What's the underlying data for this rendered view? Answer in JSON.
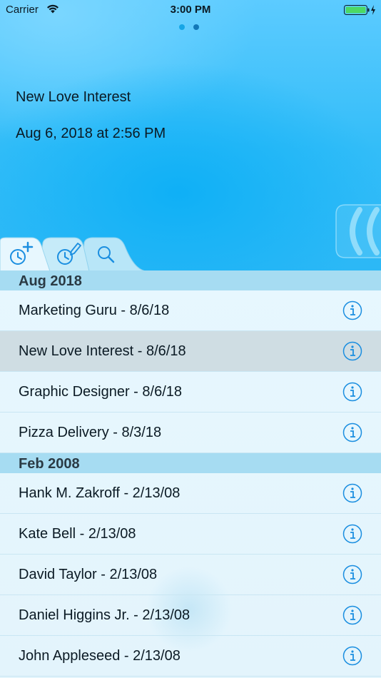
{
  "status_bar": {
    "carrier": "Carrier",
    "time": "3:00 PM",
    "battery_level": 1.0,
    "charging": true
  },
  "page_indicator": {
    "count": 2,
    "active_index": 1
  },
  "entry": {
    "title": "New Love Interest",
    "datetime": "Aug 6, 2018 at 2:56 PM"
  },
  "tabs": [
    {
      "icon": "add-timer-icon",
      "active": true
    },
    {
      "icon": "edit-timer-icon",
      "active": false
    },
    {
      "icon": "search-icon",
      "active": false
    }
  ],
  "sections": [
    {
      "title": "Aug 2018",
      "rows": [
        {
          "label": "Marketing Guru  -  8/6/18",
          "selected": false
        },
        {
          "label": "New Love Interest  -  8/6/18",
          "selected": true
        },
        {
          "label": "Graphic Designer  -  8/6/18",
          "selected": false
        },
        {
          "label": "Pizza Delivery  -  8/3/18",
          "selected": false
        }
      ]
    },
    {
      "title": "Feb 2008",
      "rows": [
        {
          "label": "Hank M. Zakroff  -  2/13/08",
          "selected": false
        },
        {
          "label": "Kate Bell  -  2/13/08",
          "selected": false
        },
        {
          "label": "David Taylor  -  2/13/08",
          "selected": false
        },
        {
          "label": "Daniel Higgins Jr.  -  2/13/08",
          "selected": false
        },
        {
          "label": "John Appleseed  -  2/13/08",
          "selected": false
        }
      ]
    }
  ],
  "colors": {
    "accent": "#1a8ee0",
    "header_blue": "#33bdf8",
    "section_header": "#a6dcf2",
    "selected_row": "#cfdde3"
  }
}
